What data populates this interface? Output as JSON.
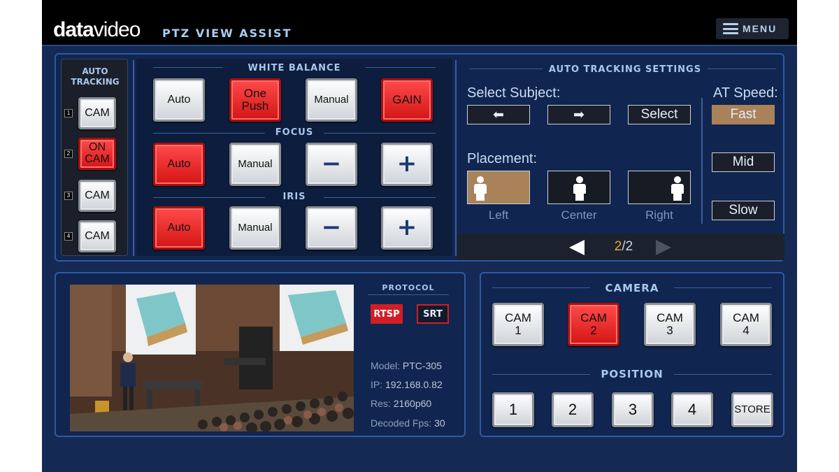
{
  "header": {
    "logo_part1": "data",
    "logo_part2": "video",
    "title": "PTZ VIEW ASSIST",
    "menu_label": "MENU"
  },
  "auto_tracking": {
    "title_line1": "AUTO",
    "title_line2": "TRACKING",
    "items": [
      {
        "num": "1",
        "label": "CAM",
        "state": "off"
      },
      {
        "num": "2",
        "label_line1": "ON",
        "label_line2": "CAM",
        "state": "on"
      },
      {
        "num": "3",
        "label": "CAM",
        "state": "off"
      },
      {
        "num": "4",
        "label": "CAM",
        "state": "off"
      }
    ]
  },
  "white_balance": {
    "title": "WHITE BALANCE",
    "auto": "Auto",
    "one_push_line1": "One",
    "one_push_line2": "Push",
    "manual": "Manual",
    "gain": "GAIN"
  },
  "focus": {
    "title": "FOCUS",
    "auto": "Auto",
    "manual": "Manual",
    "minus": "−",
    "plus": "+"
  },
  "iris": {
    "title": "IRIS",
    "auto": "Auto",
    "manual": "Manual",
    "minus": "−",
    "plus": "+"
  },
  "tracking_settings": {
    "title": "AUTO TRACKING SETTINGS",
    "select_subject_label": "Select Subject:",
    "left_arrow": "⬅",
    "right_arrow": "➡",
    "select_label": "Select",
    "placement_label": "Placement:",
    "placements": [
      "Left",
      "Center",
      "Right"
    ],
    "active_placement": "Left",
    "speed_label": "AT Speed:",
    "speeds": [
      "Fast",
      "Mid",
      "Slow"
    ],
    "active_speed": "Fast"
  },
  "pager": {
    "current": "2",
    "total": "/2"
  },
  "protocol": {
    "title": "PROTOCOL",
    "rtsp": "RTSP",
    "srt": "SRT",
    "active": "RTSP"
  },
  "stream_info": {
    "model_label": "Model:",
    "model_value": "PTC-305",
    "ip_label": "IP:",
    "ip_value": "192.168.0.82",
    "res_label": "Res:",
    "res_value": "2160p60",
    "fps_label": "Decoded Fps:",
    "fps_value": "30"
  },
  "camera": {
    "title": "CAMERA",
    "cams": [
      {
        "line1": "CAM",
        "line2": "1"
      },
      {
        "line1": "CAM",
        "line2": "2"
      },
      {
        "line1": "CAM",
        "line2": "3"
      },
      {
        "line1": "CAM",
        "line2": "4"
      }
    ],
    "active_cam": "2"
  },
  "position": {
    "title": "POSITION",
    "buttons": [
      "1",
      "2",
      "3",
      "4"
    ],
    "store": "STORE"
  },
  "colors": {
    "background": "#142a55",
    "active_red": "#e02020",
    "active_tan": "#a9825a",
    "accent_text": "#a8c8ec",
    "pager_current": "#e8a63a"
  }
}
